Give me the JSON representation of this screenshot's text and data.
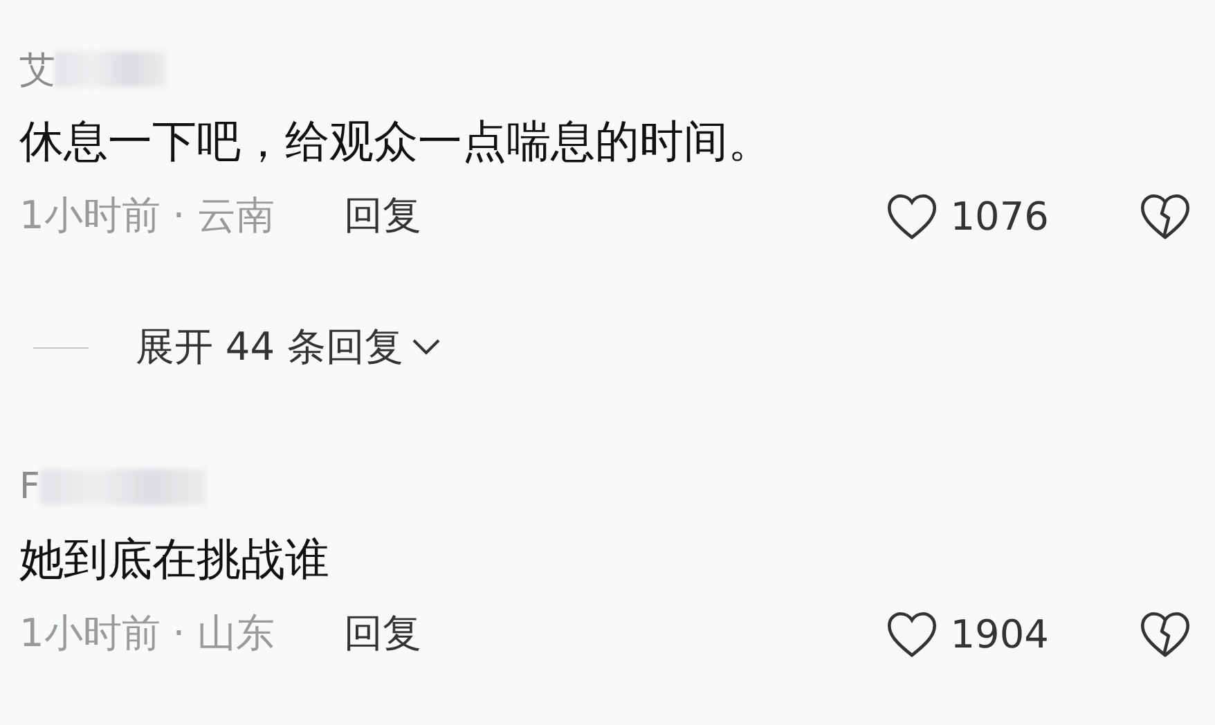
{
  "comments": [
    {
      "author": {
        "visible": "艾",
        "kind": "blurred"
      },
      "text": "休息一下吧，给观众一点喘息的时间。",
      "meta": "1小时前 · 云南",
      "reply": "回复",
      "likes": "1076",
      "liked": false,
      "expand": {
        "label": "展开 44 条回复"
      }
    },
    {
      "author": {
        "visible": "F",
        "kind": "blurred"
      },
      "text": "她到底在挑战谁",
      "meta": "1小时前 · 山东",
      "reply": "回复",
      "likes": "1904",
      "liked": false
    }
  ]
}
